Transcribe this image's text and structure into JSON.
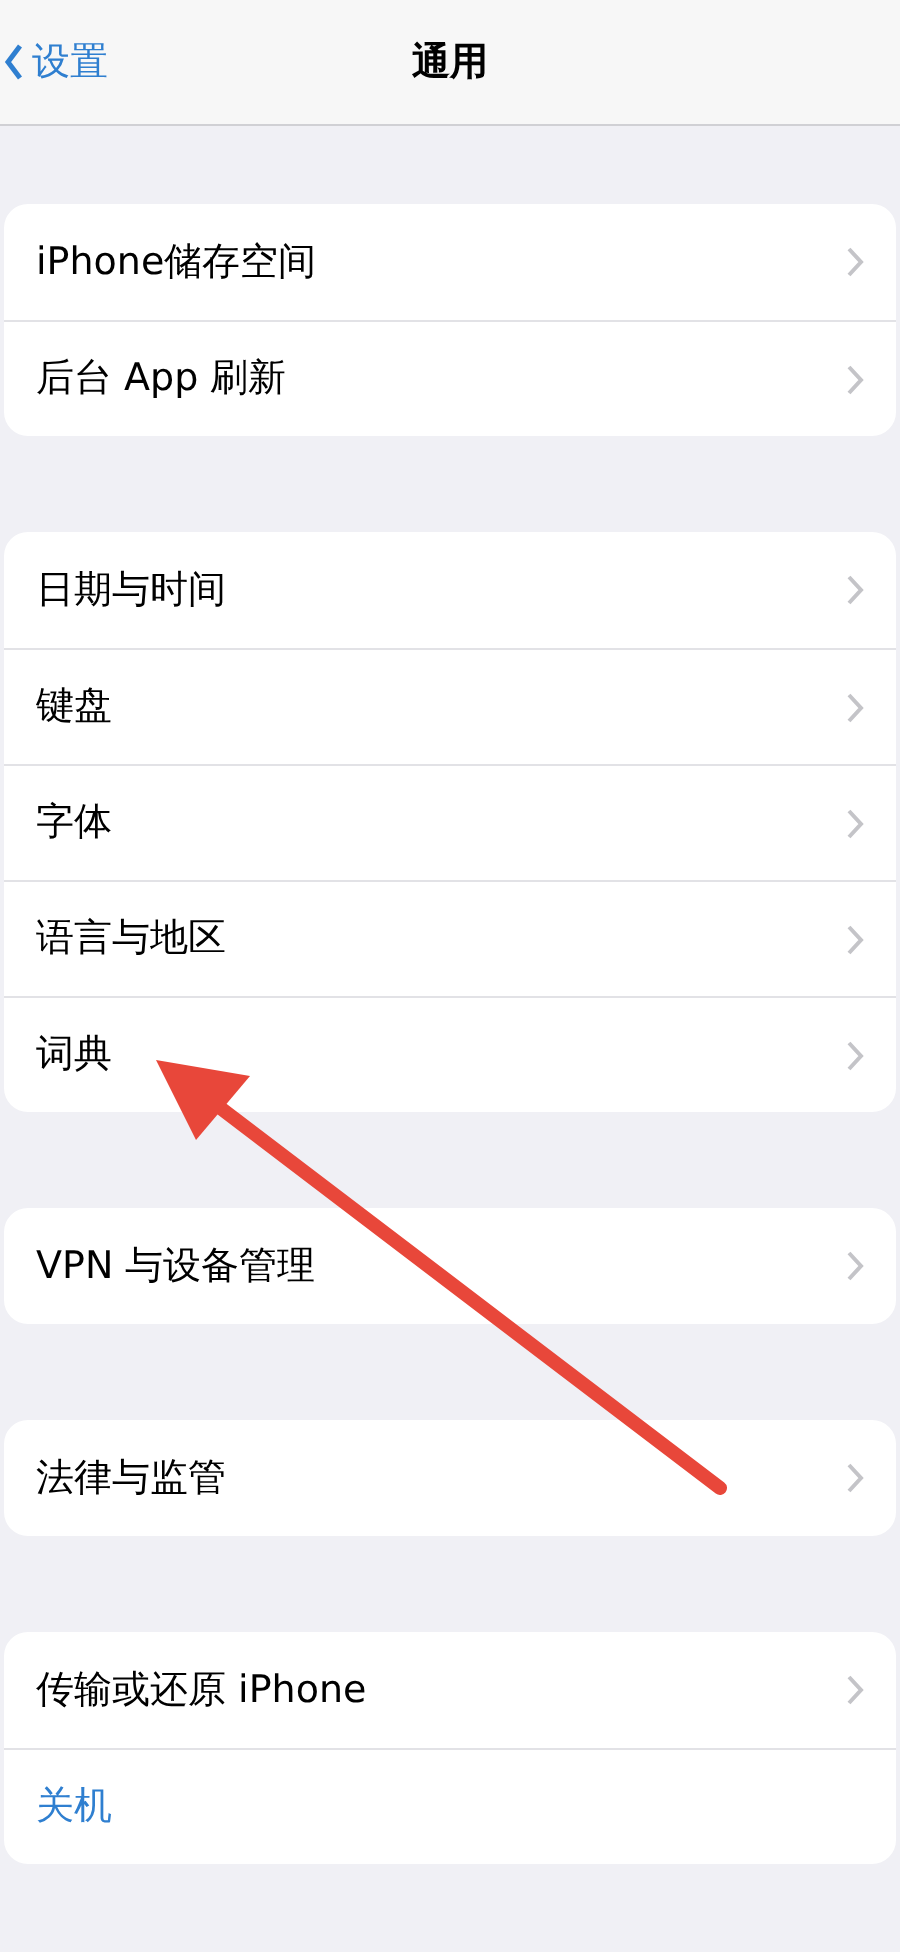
{
  "nav_bar": {
    "back": "设置",
    "title": "通用"
  },
  "groups": [
    {
      "rows": [
        {
          "label": "iPhone储存空间",
          "kind": "link"
        },
        {
          "label": "后台 App 刷新",
          "kind": "link"
        }
      ]
    },
    {
      "rows": [
        {
          "label": "日期与时间",
          "kind": "link"
        },
        {
          "label": "键盘",
          "kind": "link"
        },
        {
          "label": "字体",
          "kind": "link"
        },
        {
          "label": "语言与地区",
          "kind": "link"
        },
        {
          "label": "词典",
          "kind": "link"
        }
      ]
    },
    {
      "rows": [
        {
          "label": "VPN 与设备管理",
          "kind": "link"
        }
      ]
    },
    {
      "rows": [
        {
          "label": "法律与监管",
          "kind": "link"
        }
      ]
    },
    {
      "rows": [
        {
          "label": "传输或还原 iPhone",
          "kind": "link"
        },
        {
          "label": "关机",
          "kind": "action"
        }
      ]
    }
  ]
}
